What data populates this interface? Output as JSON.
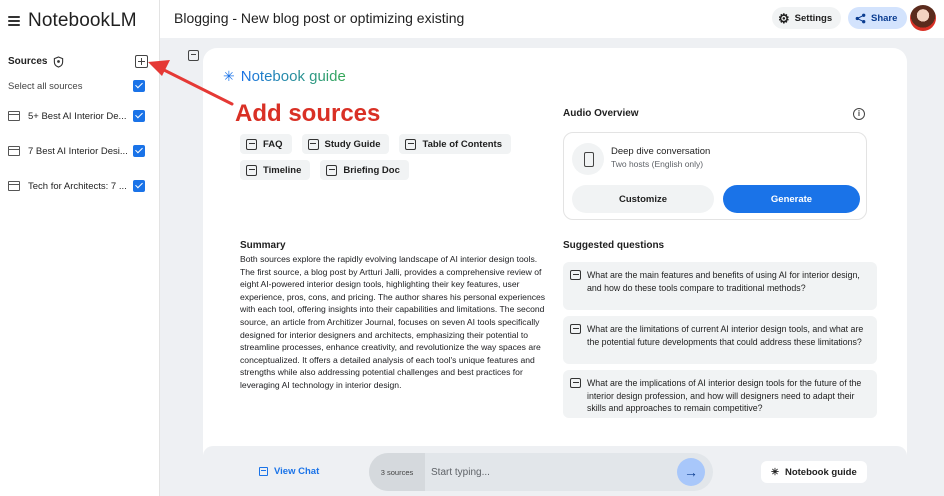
{
  "app": {
    "name": "NotebookLM"
  },
  "header": {
    "title": "Blogging - New blog post or optimizing existing",
    "settings_label": "Settings",
    "share_label": "Share"
  },
  "sidebar": {
    "sources_title": "Sources",
    "select_all_label": "Select all sources",
    "sources": [
      {
        "label": "5+ Best AI Interior De...",
        "checked": true
      },
      {
        "label": "7 Best AI Interior Desi...",
        "checked": true
      },
      {
        "label": "Tech for Architects: 7 ...",
        "checked": true
      }
    ]
  },
  "annotation": {
    "text": "Add sources",
    "color": "#d93025"
  },
  "guide": {
    "title": "Notebook guide",
    "chips": [
      "FAQ",
      "Study Guide",
      "Table of Contents",
      "Timeline",
      "Briefing Doc"
    ],
    "summary_title": "Summary",
    "summary_text": "Both sources explore the rapidly evolving landscape of AI interior design tools. The first source, a blog post by Artturi Jalli, provides a comprehensive review of eight AI-powered interior design tools, highlighting their key features, user experience, pros, cons, and pricing. The author shares his personal experiences with each tool, offering insights into their capabilities and limitations. The second source, an article from Architizer Journal, focuses on seven AI tools specifically designed for interior designers and architects, emphasizing their potential to streamline processes, enhance creativity, and revolutionize the way spaces are conceptualized. It offers a detailed analysis of each tool's unique features and strengths while also addressing potential challenges and best practices for leveraging AI technology in interior design."
  },
  "audio": {
    "title": "Audio Overview",
    "info_glyph": "i",
    "card_title": "Deep dive conversation",
    "card_subtitle": "Two hosts (English only)",
    "customize_label": "Customize",
    "generate_label": "Generate"
  },
  "suggested": {
    "title": "Suggested questions",
    "questions": [
      "What are the main features and benefits of using AI for interior design, and how do these tools compare to traditional methods?",
      "What are the limitations of current AI interior design tools, and what are the potential future developments that could address these limitations?",
      "What are the implications of AI interior design tools for the future of the interior design profession, and how will designers need to adapt their skills and approaches to remain competitive?"
    ]
  },
  "bottom": {
    "view_chat_label": "View Chat",
    "source_count": "3 sources",
    "input_placeholder": "Start typing...",
    "send_glyph": "→",
    "notebook_guide_label": "Notebook guide",
    "sparkle_glyph": "✳"
  },
  "colors": {
    "accent": "#1a73e8",
    "annotation": "#d93025",
    "share_bg": "#d3e3fd"
  }
}
